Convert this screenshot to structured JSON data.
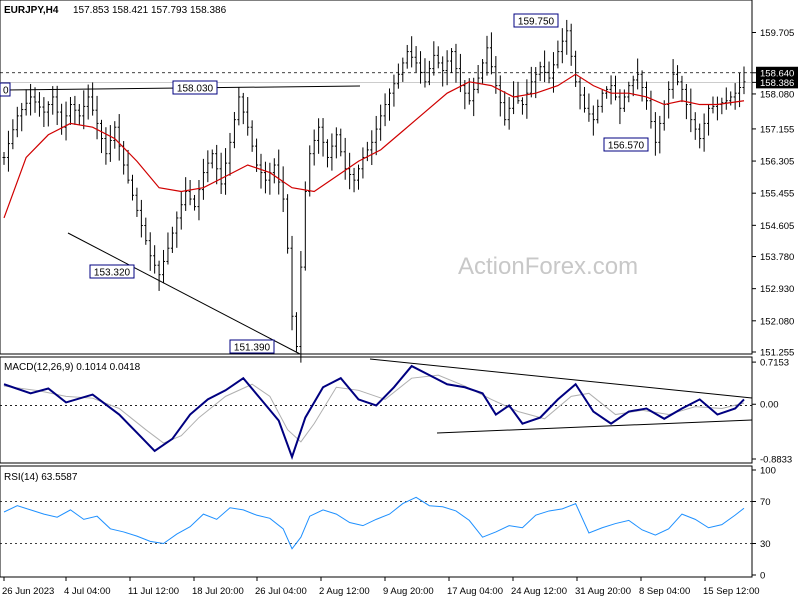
{
  "chart_data": {
    "type": "candlestick",
    "symbol_header": "EURJPY,H4",
    "ohlc_header": [
      "157.853",
      "158.421",
      "157.793",
      "158.386"
    ],
    "watermark": "ActionForex.com",
    "colors": {
      "price": "#000000",
      "ma": "#d00000",
      "macd": "#000080",
      "signal": "#b0b0b0",
      "rsi": "#1e90ff",
      "box_border": "#000080"
    },
    "x_tick_labels": [
      "26 Jun 2023",
      "4 Jul 04:00",
      "11 Jul 12:00",
      "18 Jul 20:00",
      "26 Jul 04:00",
      "2 Aug 12:00",
      "9 Aug 20:00",
      "17 Aug 04:00",
      "24 Aug 12:00",
      "31 Aug 20:00",
      "8 Sep 04:00",
      "15 Sep 12:00"
    ],
    "price_panel": {
      "ylim": [
        151.255,
        160.3
      ],
      "y_ticks": [
        "159.705",
        "158.640",
        "158.386",
        "158.080",
        "157.155",
        "156.305",
        "155.455",
        "154.605",
        "153.780",
        "152.930",
        "152.080",
        "151.255"
      ],
      "current_price": "158.386",
      "resistance_level": "158.640",
      "annotations": [
        "159.750",
        "158.030",
        "156.570",
        "153.320",
        "151.390"
      ],
      "left_cut_label": "0",
      "price_path": [
        [
          0,
          156.4
        ],
        [
          3,
          157.5
        ],
        [
          6,
          158.0
        ],
        [
          9,
          157.6
        ],
        [
          11,
          158.0
        ],
        [
          13,
          157.2
        ],
        [
          15,
          157.8
        ],
        [
          17,
          157.5
        ],
        [
          19,
          158.0
        ],
        [
          21,
          157.3
        ],
        [
          23,
          156.5
        ],
        [
          25,
          157.2
        ],
        [
          27,
          156.2
        ],
        [
          29,
          155.4
        ],
        [
          31,
          154.6
        ],
        [
          33,
          153.8
        ],
        [
          35,
          153.3
        ],
        [
          37,
          154.0
        ],
        [
          39,
          154.8
        ],
        [
          41,
          155.5
        ],
        [
          43,
          155.1
        ],
        [
          45,
          156.0
        ],
        [
          47,
          156.5
        ],
        [
          49,
          155.7
        ],
        [
          51,
          156.8
        ],
        [
          53,
          158.0
        ],
        [
          55,
          157.2
        ],
        [
          57,
          156.2
        ],
        [
          59,
          155.8
        ],
        [
          61,
          156.2
        ],
        [
          63,
          155.3
        ],
        [
          64,
          154.0
        ],
        [
          65,
          152.2
        ],
        [
          66,
          151.4
        ],
        [
          67,
          153.5
        ],
        [
          68,
          155.5
        ],
        [
          69,
          156.5
        ],
        [
          71,
          157.2
        ],
        [
          73,
          156.4
        ],
        [
          75,
          157.0
        ],
        [
          77,
          156.1
        ],
        [
          79,
          155.8
        ],
        [
          81,
          156.4
        ],
        [
          83,
          156.8
        ],
        [
          85,
          157.5
        ],
        [
          87,
          158.1
        ],
        [
          89,
          158.6
        ],
        [
          91,
          159.2
        ],
        [
          93,
          158.9
        ],
        [
          95,
          158.4
        ],
        [
          97,
          159.1
        ],
        [
          99,
          158.7
        ],
        [
          101,
          159.2
        ],
        [
          103,
          158.3
        ],
        [
          105,
          157.9
        ],
        [
          107,
          158.5
        ],
        [
          109,
          159.3
        ],
        [
          111,
          158.3
        ],
        [
          113,
          157.4
        ],
        [
          115,
          158.0
        ],
        [
          117,
          157.8
        ],
        [
          119,
          158.4
        ],
        [
          121,
          158.8
        ],
        [
          123,
          158.5
        ],
        [
          125,
          159.2
        ],
        [
          127,
          159.75
        ],
        [
          129,
          158.4
        ],
        [
          131,
          157.7
        ],
        [
          133,
          157.4
        ],
        [
          135,
          158.1
        ],
        [
          137,
          158.3
        ],
        [
          139,
          157.7
        ],
        [
          141,
          158.3
        ],
        [
          143,
          158.6
        ],
        [
          145,
          157.9
        ],
        [
          147,
          156.8
        ],
        [
          149,
          157.8
        ],
        [
          151,
          158.6
        ],
        [
          153,
          158.2
        ],
        [
          155,
          157.4
        ],
        [
          157,
          156.9
        ],
        [
          159,
          157.7
        ],
        [
          161,
          157.8
        ],
        [
          163,
          157.9
        ],
        [
          165,
          158.1
        ],
        [
          167,
          158.4
        ]
      ],
      "ma_path": [
        [
          0,
          154.8
        ],
        [
          5,
          156.4
        ],
        [
          10,
          157.0
        ],
        [
          15,
          157.3
        ],
        [
          20,
          157.2
        ],
        [
          25,
          156.9
        ],
        [
          30,
          156.3
        ],
        [
          35,
          155.6
        ],
        [
          40,
          155.5
        ],
        [
          45,
          155.6
        ],
        [
          50,
          155.9
        ],
        [
          55,
          156.2
        ],
        [
          60,
          156.0
        ],
        [
          65,
          155.6
        ],
        [
          70,
          155.5
        ],
        [
          75,
          155.9
        ],
        [
          80,
          156.3
        ],
        [
          85,
          156.6
        ],
        [
          90,
          157.1
        ],
        [
          95,
          157.6
        ],
        [
          100,
          158.1
        ],
        [
          105,
          158.4
        ],
        [
          110,
          158.3
        ],
        [
          115,
          158.0
        ],
        [
          120,
          158.1
        ],
        [
          125,
          158.3
        ],
        [
          129,
          158.6
        ],
        [
          133,
          158.3
        ],
        [
          137,
          158.1
        ],
        [
          141,
          158.1
        ],
        [
          145,
          158.0
        ],
        [
          149,
          157.8
        ],
        [
          153,
          157.9
        ],
        [
          157,
          157.8
        ],
        [
          161,
          157.8
        ],
        [
          167,
          157.9
        ]
      ]
    },
    "macd_panel": {
      "title": "MACD(12,26,9) 0.1014 0.0418",
      "ylim": [
        -0.9,
        0.75
      ],
      "y_ticks": [
        "0.7153",
        "0.00",
        "0.00",
        "-0.8833"
      ],
      "macd_path": [
        [
          0,
          0.35
        ],
        [
          6,
          0.2
        ],
        [
          10,
          0.28
        ],
        [
          14,
          0.05
        ],
        [
          20,
          0.18
        ],
        [
          26,
          -0.15
        ],
        [
          30,
          -0.45
        ],
        [
          34,
          -0.75
        ],
        [
          38,
          -0.55
        ],
        [
          42,
          -0.15
        ],
        [
          46,
          0.1
        ],
        [
          50,
          0.25
        ],
        [
          54,
          0.45
        ],
        [
          58,
          0.1
        ],
        [
          62,
          -0.25
        ],
        [
          65,
          -0.85
        ],
        [
          68,
          -0.2
        ],
        [
          72,
          0.3
        ],
        [
          76,
          0.45
        ],
        [
          80,
          0.1
        ],
        [
          84,
          0.0
        ],
        [
          88,
          0.3
        ],
        [
          92,
          0.65
        ],
        [
          96,
          0.5
        ],
        [
          100,
          0.35
        ],
        [
          104,
          0.3
        ],
        [
          108,
          0.2
        ],
        [
          111,
          -0.15
        ],
        [
          114,
          0.0
        ],
        [
          117,
          -0.3
        ],
        [
          121,
          -0.2
        ],
        [
          125,
          0.1
        ],
        [
          129,
          0.35
        ],
        [
          133,
          -0.1
        ],
        [
          137,
          -0.3
        ],
        [
          141,
          -0.1
        ],
        [
          145,
          -0.05
        ],
        [
          149,
          -0.22
        ],
        [
          153,
          -0.05
        ],
        [
          157,
          0.1
        ],
        [
          161,
          -0.15
        ],
        [
          165,
          -0.05
        ],
        [
          167,
          0.1
        ]
      ],
      "signal_path": [
        [
          0,
          0.32
        ],
        [
          8,
          0.24
        ],
        [
          14,
          0.15
        ],
        [
          20,
          0.12
        ],
        [
          26,
          -0.05
        ],
        [
          32,
          -0.4
        ],
        [
          36,
          -0.62
        ],
        [
          40,
          -0.5
        ],
        [
          44,
          -0.2
        ],
        [
          50,
          0.15
        ],
        [
          56,
          0.35
        ],
        [
          60,
          0.15
        ],
        [
          64,
          -0.4
        ],
        [
          67,
          -0.6
        ],
        [
          70,
          -0.3
        ],
        [
          75,
          0.3
        ],
        [
          80,
          0.25
        ],
        [
          86,
          0.1
        ],
        [
          92,
          0.45
        ],
        [
          98,
          0.5
        ],
        [
          104,
          0.32
        ],
        [
          110,
          0.1
        ],
        [
          116,
          -0.1
        ],
        [
          122,
          -0.22
        ],
        [
          128,
          0.15
        ],
        [
          132,
          0.2
        ],
        [
          138,
          -0.15
        ],
        [
          144,
          -0.08
        ],
        [
          150,
          -0.15
        ],
        [
          156,
          -0.02
        ],
        [
          162,
          -0.05
        ],
        [
          167,
          0.04
        ]
      ]
    },
    "rsi_panel": {
      "title": "RSI(14) 63.5587",
      "ylim": [
        0,
        100
      ],
      "y_ticks": [
        "100",
        "70",
        "30",
        "0"
      ],
      "rsi_path": [
        [
          0,
          60
        ],
        [
          3,
          66
        ],
        [
          6,
          62
        ],
        [
          9,
          58
        ],
        [
          12,
          55
        ],
        [
          15,
          62
        ],
        [
          18,
          53
        ],
        [
          21,
          56
        ],
        [
          24,
          44
        ],
        [
          27,
          41
        ],
        [
          30,
          37
        ],
        [
          33,
          32
        ],
        [
          36,
          30
        ],
        [
          39,
          39
        ],
        [
          42,
          46
        ],
        [
          45,
          58
        ],
        [
          48,
          53
        ],
        [
          51,
          64
        ],
        [
          54,
          62
        ],
        [
          57,
          57
        ],
        [
          60,
          54
        ],
        [
          63,
          44
        ],
        [
          65,
          25
        ],
        [
          67,
          36
        ],
        [
          69,
          56
        ],
        [
          72,
          62
        ],
        [
          75,
          58
        ],
        [
          78,
          50
        ],
        [
          81,
          47
        ],
        [
          84,
          53
        ],
        [
          87,
          58
        ],
        [
          90,
          68
        ],
        [
          93,
          74
        ],
        [
          96,
          66
        ],
        [
          99,
          65
        ],
        [
          102,
          61
        ],
        [
          105,
          52
        ],
        [
          108,
          36
        ],
        [
          111,
          41
        ],
        [
          114,
          47
        ],
        [
          117,
          45
        ],
        [
          120,
          57
        ],
        [
          123,
          61
        ],
        [
          126,
          63
        ],
        [
          129,
          68
        ],
        [
          132,
          40
        ],
        [
          135,
          45
        ],
        [
          138,
          49
        ],
        [
          141,
          52
        ],
        [
          144,
          43
        ],
        [
          147,
          38
        ],
        [
          150,
          44
        ],
        [
          153,
          58
        ],
        [
          156,
          53
        ],
        [
          159,
          45
        ],
        [
          162,
          48
        ],
        [
          165,
          57
        ],
        [
          167,
          63.6
        ]
      ]
    },
    "n_bars": 168
  }
}
